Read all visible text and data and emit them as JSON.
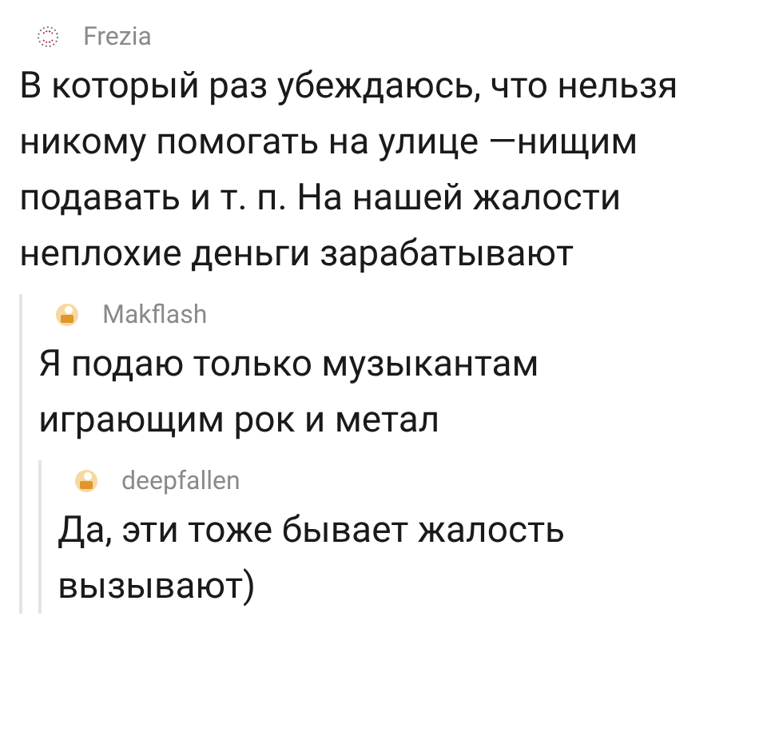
{
  "comments": [
    {
      "author": "Frezia",
      "kind": "sketch",
      "text": "В который раз убеждаюсь, что нельзя никому помогать на улице —нищим подавать и т. п. На нашей жалости неплохие деньги зарабатывают",
      "children": [
        {
          "author": "Makflash",
          "kind": "face",
          "text": "Я подаю только музыкантам играющим рок и метал",
          "children": [
            {
              "author": "deepfallen",
              "kind": "face",
              "text": "Да, эти тоже бывает жалость вызывают)"
            }
          ]
        }
      ]
    }
  ]
}
